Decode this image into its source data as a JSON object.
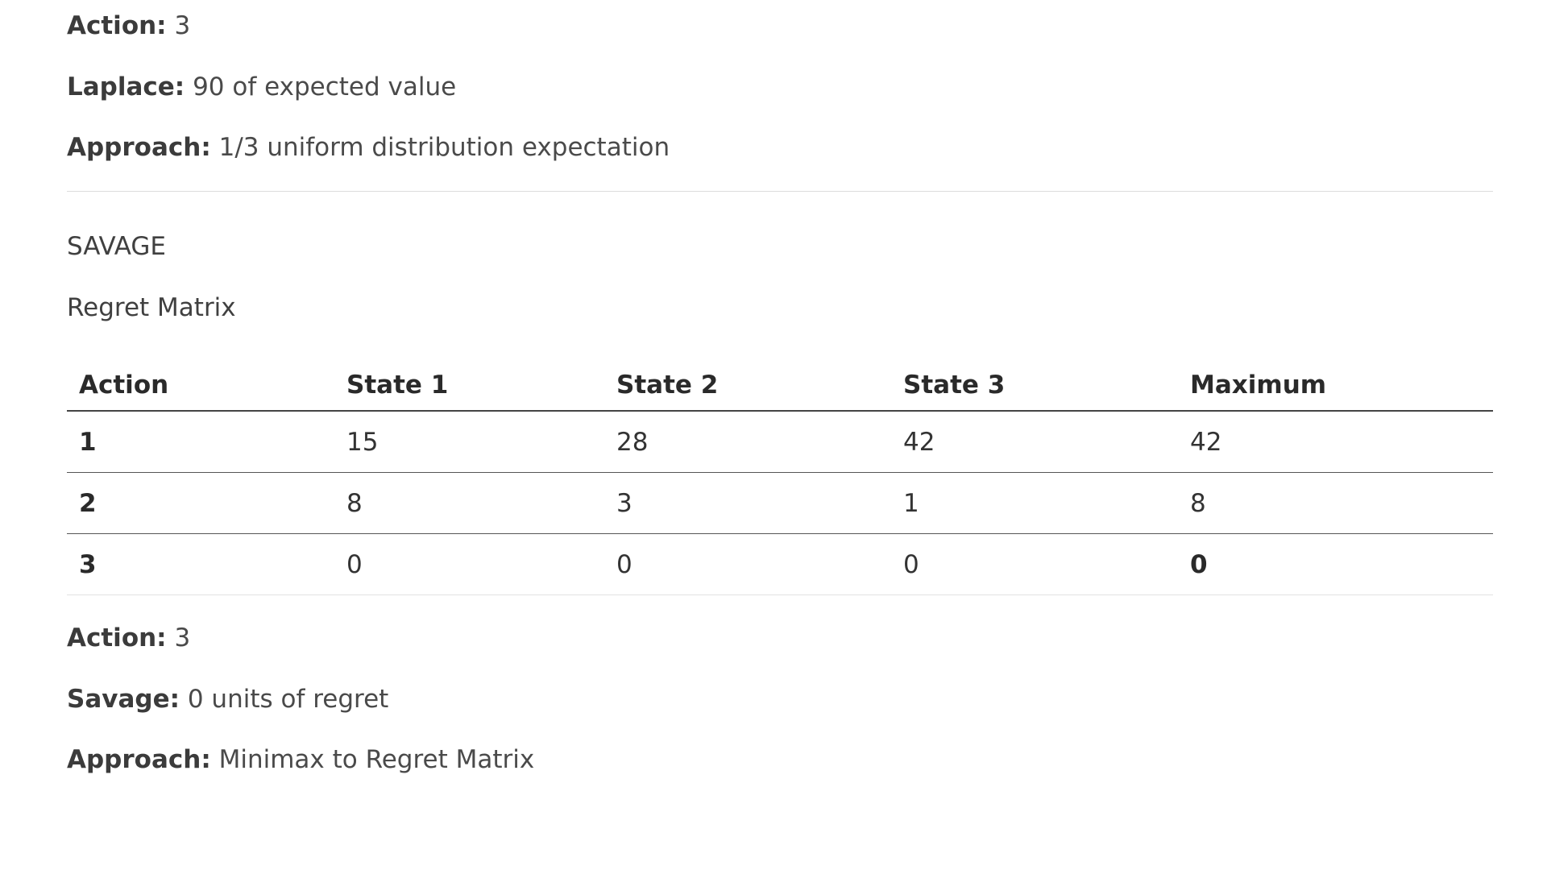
{
  "laplace": {
    "action": {
      "label": "Action:",
      "value": "3"
    },
    "result": {
      "label": "Laplace:",
      "value": "90 of expected value"
    },
    "approach": {
      "label": "Approach:",
      "value": "1/3 uniform distribution expectation"
    }
  },
  "savage": {
    "section_title": "SAVAGE",
    "matrix_title": "Regret Matrix",
    "table": {
      "headers": [
        "Action",
        "State 1",
        "State 2",
        "State 3",
        "Maximum"
      ],
      "rows": [
        [
          "1",
          "15",
          "28",
          "42",
          "42"
        ],
        [
          "2",
          "8",
          "3",
          "1",
          "8"
        ],
        [
          "3",
          "0",
          "0",
          "0",
          "0"
        ]
      ]
    },
    "action": {
      "label": "Action:",
      "value": "3"
    },
    "result": {
      "label": "Savage:",
      "value": "0 units of regret"
    },
    "approach": {
      "label": "Approach:",
      "value": "Minimax to Regret Matrix"
    }
  }
}
